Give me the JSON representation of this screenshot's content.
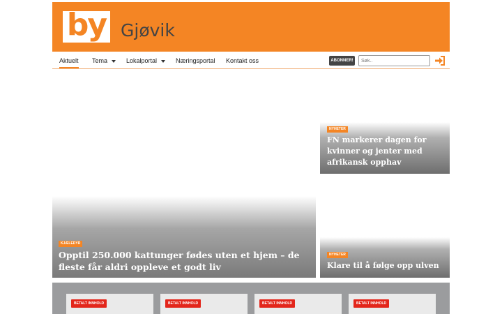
{
  "site": {
    "logo_text": "by",
    "city": "Gjøvik",
    "brand_color": "#f48524"
  },
  "nav": {
    "items": [
      {
        "label": "Aktuelt",
        "active": true,
        "dropdown": false
      },
      {
        "label": "Tema",
        "active": false,
        "dropdown": true
      },
      {
        "label": "Lokalportal",
        "active": false,
        "dropdown": true
      },
      {
        "label": "Næringsportal",
        "active": false,
        "dropdown": false
      },
      {
        "label": "Kontakt oss",
        "active": false,
        "dropdown": false
      }
    ],
    "subscribe_label": "ABONNER!",
    "search_placeholder": "Søk..",
    "login_icon": "sign-in-icon"
  },
  "articles": {
    "main": {
      "category": "KJÆLEDYR",
      "title": "Opptil 250.000 kattunger fødes uten et hjem – de fleste får aldri oppleve et godt liv"
    },
    "side1": {
      "category": "NYHETER",
      "title": "FN markerer dagen for kvinner og jenter med afrikansk opphav"
    },
    "side2": {
      "category": "NYHETER",
      "title": "Klare til å følge opp ulven"
    }
  },
  "paid": {
    "label": "BETALT INNHOLD",
    "badge_color": "#e3261b",
    "cards": [
      {
        "badge": "BETALT INNHOLD"
      },
      {
        "badge": "BETALT INNHOLD"
      },
      {
        "badge": "BETALT INNHOLD"
      },
      {
        "badge": "BETALT INNHOLD"
      }
    ]
  }
}
